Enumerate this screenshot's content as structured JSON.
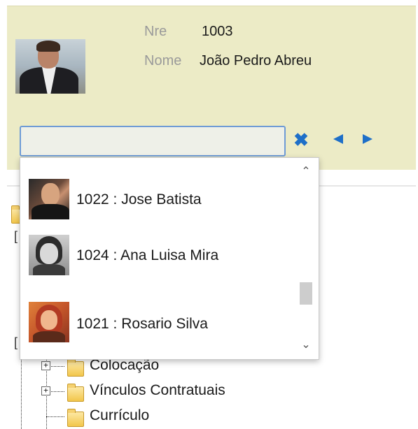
{
  "employee": {
    "nre_label": "Nre",
    "nre_value": "1003",
    "name_label": "Nome",
    "name_value": "João Pedro Abreu"
  },
  "search": {
    "value": "",
    "placeholder": ""
  },
  "toolbar": {
    "clear_icon": "close-x-icon",
    "prev_icon": "arrow-left-icon",
    "next_icon": "arrow-right-icon"
  },
  "dropdown": {
    "items": [
      {
        "label": "1022 : Jose Batista"
      },
      {
        "label": "1024 : Ana Luisa Mira"
      },
      {
        "label": "1021 : Rosario Silva"
      }
    ],
    "scroll_up": "⌃",
    "scroll_down": "⌄"
  },
  "tree": {
    "items": [
      {
        "label": "Colocação",
        "expander": "+"
      },
      {
        "label": "Vínculos Contratuais",
        "expander": "+"
      },
      {
        "label": "Currículo",
        "expander": ""
      }
    ],
    "bracket": "["
  },
  "colors": {
    "header_bg": "#ecebc6",
    "accent": "#1e6fc8",
    "search_border": "#6e9bd6"
  }
}
